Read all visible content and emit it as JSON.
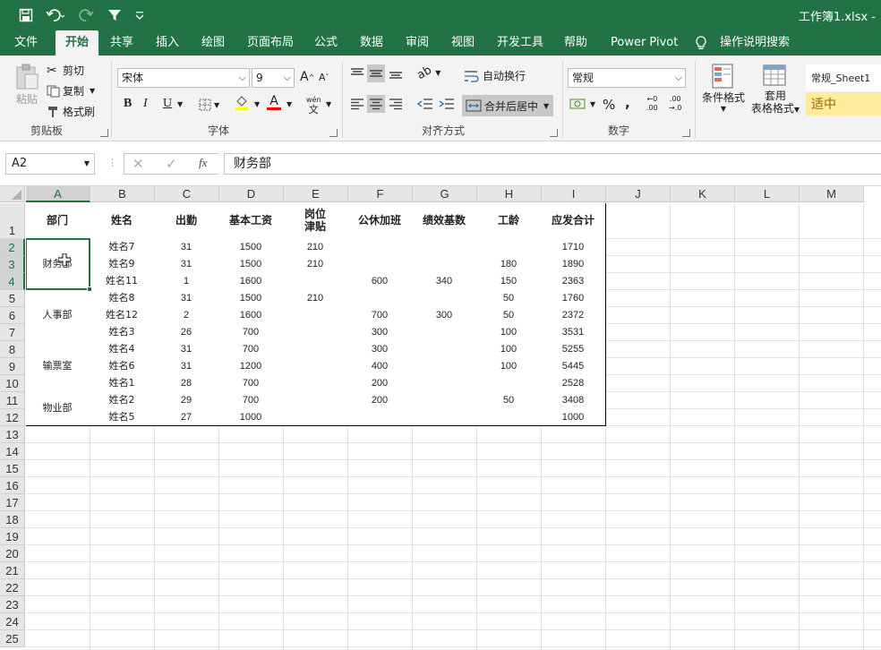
{
  "titlebar": {
    "filename": "工作簿1.xlsx -"
  },
  "tabs": [
    "文件",
    "开始",
    "共享",
    "插入",
    "绘图",
    "页面布局",
    "公式",
    "数据",
    "审阅",
    "视图",
    "开发工具",
    "帮助",
    "Power Pivot",
    "操作说明搜索"
  ],
  "ribbon": {
    "clipboard": {
      "paste": "粘贴",
      "cut": "剪切",
      "copy": "复制",
      "format_painter": "格式刷",
      "label": "剪贴板"
    },
    "font": {
      "name": "宋体",
      "size": "9",
      "grow": "A",
      "shrink": "A",
      "bold": "B",
      "italic": "I",
      "underline": "U",
      "font_color_letter": "A",
      "phonetic_top": "wén",
      "phonetic_bottom": "文",
      "label": "字体"
    },
    "alignment": {
      "wrap": "自动换行",
      "merge": "合并后居中",
      "label": "对齐方式"
    },
    "number": {
      "format": "常规",
      "percent": "%",
      "comma": ",",
      "inc_decimal_top": "←0",
      "inc_decimal_bottom": ".00",
      "dec_decimal_top": ".00",
      "dec_decimal_bottom": "→.0",
      "label": "数字"
    },
    "styles": {
      "conditional": "条件格式",
      "table_top": "套用",
      "table_bottom": "表格格式",
      "style_normal": "常规_Sheet1",
      "style_neutral": "适中"
    }
  },
  "formula_bar": {
    "name_box": "A2",
    "cancel": "✕",
    "enter": "✓",
    "fx": "fx",
    "content": "财务部"
  },
  "columns": [
    "A",
    "B",
    "C",
    "D",
    "E",
    "F",
    "G",
    "H",
    "I",
    "J",
    "K",
    "L",
    "M"
  ],
  "rows": [
    "1",
    "2",
    "3",
    "4",
    "5",
    "6",
    "7",
    "8",
    "9",
    "10",
    "11",
    "12",
    "13",
    "14",
    "15",
    "16",
    "17",
    "18",
    "19",
    "20",
    "21",
    "22",
    "23",
    "24",
    "25"
  ],
  "table": {
    "headers": [
      "部门",
      "姓名",
      "出勤",
      "基本工资",
      "岗位\n津贴",
      "公休加班",
      "绩效基数",
      "工龄",
      "应发合计"
    ],
    "departments": [
      {
        "name": "财务部",
        "rows": 3
      },
      {
        "name": "人事部",
        "rows": 3
      },
      {
        "name": "输票室",
        "rows": 3
      },
      {
        "name": "物业部",
        "rows": 2
      }
    ],
    "rows": [
      [
        "姓名7",
        "31",
        "1500",
        "210",
        "",
        "",
        "",
        "1710"
      ],
      [
        "姓名9",
        "31",
        "1500",
        "210",
        "",
        "",
        "180",
        "1890"
      ],
      [
        "姓名11",
        "1",
        "1600",
        "",
        "600",
        "340",
        "150",
        "2363"
      ],
      [
        "姓名8",
        "31",
        "1500",
        "210",
        "",
        "",
        "50",
        "1760"
      ],
      [
        "姓名12",
        "2",
        "1600",
        "",
        "700",
        "300",
        "50",
        "2372"
      ],
      [
        "姓名3",
        "26",
        "700",
        "",
        "300",
        "",
        "100",
        "3531"
      ],
      [
        "姓名4",
        "31",
        "700",
        "",
        "300",
        "",
        "100",
        "5255"
      ],
      [
        "姓名6",
        "31",
        "1200",
        "",
        "400",
        "",
        "100",
        "5445"
      ],
      [
        "姓名1",
        "28",
        "700",
        "",
        "200",
        "",
        "",
        "2528"
      ],
      [
        "姓名2",
        "29",
        "700",
        "",
        "200",
        "",
        "50",
        "3408"
      ],
      [
        "姓名5",
        "27",
        "1000",
        "",
        "",
        "",
        "",
        "1000"
      ]
    ]
  },
  "colors": {
    "accent": "#217346",
    "neutral_style": "#ffeb9c",
    "neutral_text": "#9c6500"
  }
}
